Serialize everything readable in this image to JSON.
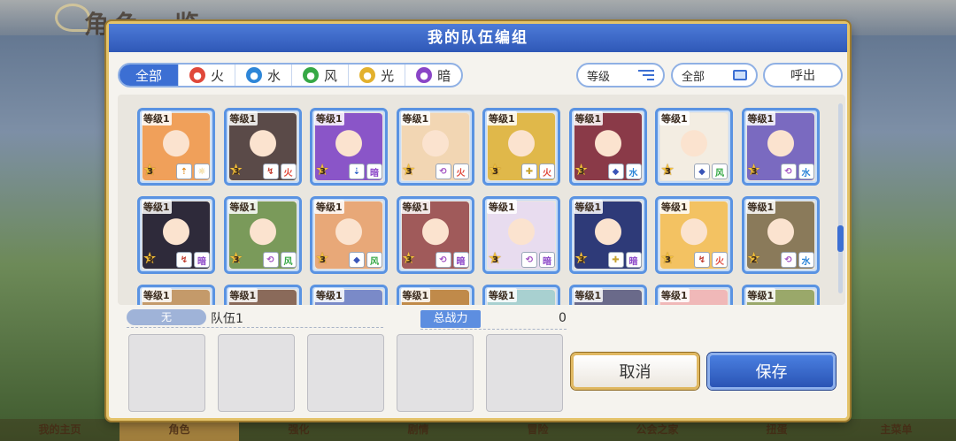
{
  "background": {
    "title": "角色一览",
    "footer_tabs": [
      "我的主页",
      "角色",
      "强化",
      "剧情",
      "冒险",
      "公会之家",
      "扭蛋",
      "主菜单"
    ]
  },
  "modal": {
    "title": "我的队伍编组",
    "filters": [
      {
        "label": "全部",
        "icon": null
      },
      {
        "label": "火",
        "icon": "fire-icon",
        "glyph": "火"
      },
      {
        "label": "水",
        "icon": "water-icon",
        "glyph": "水"
      },
      {
        "label": "风",
        "icon": "wind-icon",
        "glyph": "风"
      },
      {
        "label": "光",
        "icon": "light-icon",
        "glyph": "光"
      },
      {
        "label": "暗",
        "icon": "dark-icon",
        "glyph": "暗"
      }
    ],
    "sort_label": "等级",
    "all_label": "全部",
    "callout_label": "呼出"
  },
  "roster": {
    "level_text": "等级1",
    "cards": [
      {
        "stars": "3",
        "face": "#f0a05a",
        "roles": [
          "⇡",
          "☼"
        ],
        "role_colors": [
          "#e08a20",
          "#e3b12d"
        ]
      },
      {
        "stars": "3",
        "face": "#5a4a48",
        "roles": [
          "↯",
          "火"
        ],
        "role_colors": [
          "#c0392b",
          "#e0483a"
        ]
      },
      {
        "stars": "3",
        "face": "#8a55c8",
        "roles": [
          "⇣",
          "暗"
        ],
        "role_colors": [
          "#2e62c7",
          "#8a45c7"
        ]
      },
      {
        "stars": "3",
        "face": "#f2d6b3",
        "roles": [
          "⟲",
          "火"
        ],
        "role_colors": [
          "#a04fc0",
          "#e0483a"
        ]
      },
      {
        "stars": "3",
        "face": "#e0b84a",
        "roles": [
          "✚",
          "火"
        ],
        "role_colors": [
          "#c6a12d",
          "#e0483a"
        ]
      },
      {
        "stars": "3",
        "face": "#8a3a48",
        "roles": [
          "◆",
          "水"
        ],
        "role_colors": [
          "#3a55b8",
          "#2e86d8"
        ]
      },
      {
        "stars": "3",
        "face": "#f3ede2",
        "roles": [
          "◆",
          "风"
        ],
        "role_colors": [
          "#3a55b8",
          "#36a845"
        ]
      },
      {
        "stars": "3",
        "face": "#7a6ac0",
        "roles": [
          "⟲",
          "水"
        ],
        "role_colors": [
          "#a04fc0",
          "#2e86d8"
        ]
      },
      {
        "stars": "3",
        "face": "#2e2a3a",
        "roles": [
          "↯",
          "暗"
        ],
        "role_colors": [
          "#c0392b",
          "#8a45c7"
        ]
      },
      {
        "stars": "3",
        "face": "#7a9a5a",
        "roles": [
          "⟲",
          "风"
        ],
        "role_colors": [
          "#a04fc0",
          "#36a845"
        ]
      },
      {
        "stars": "3",
        "face": "#e8a878",
        "roles": [
          "◆",
          "风"
        ],
        "role_colors": [
          "#3a55b8",
          "#36a845"
        ]
      },
      {
        "stars": "3",
        "face": "#a05a5a",
        "roles": [
          "⟲",
          "暗"
        ],
        "role_colors": [
          "#a04fc0",
          "#8a45c7"
        ]
      },
      {
        "stars": "3",
        "face": "#e8dcef",
        "roles": [
          "⟲",
          "暗"
        ],
        "role_colors": [
          "#a04fc0",
          "#8a45c7"
        ]
      },
      {
        "stars": "3",
        "face": "#2e3a78",
        "roles": [
          "✚",
          "暗"
        ],
        "role_colors": [
          "#c6a12d",
          "#8a45c7"
        ]
      },
      {
        "stars": "3",
        "face": "#f3c262",
        "roles": [
          "↯",
          "火"
        ],
        "role_colors": [
          "#c0392b",
          "#e0483a"
        ]
      },
      {
        "stars": "2",
        "face": "#8a7a5a",
        "roles": [
          "⟲",
          "水"
        ],
        "role_colors": [
          "#a04fc0",
          "#2e86d8"
        ]
      }
    ],
    "partial_faces": [
      "#c49a6a",
      "#8a6a5a",
      "#7a8ac8",
      "#c08a4a",
      "#a8d0d0",
      "#6a6a8a",
      "#f0b8b8",
      "#9aa86a"
    ]
  },
  "team": {
    "tag": "无",
    "name": "队伍1",
    "power_label": "总战力",
    "power_value": "0"
  },
  "actions": {
    "cancel_label": "取消",
    "save_label": "保存"
  }
}
